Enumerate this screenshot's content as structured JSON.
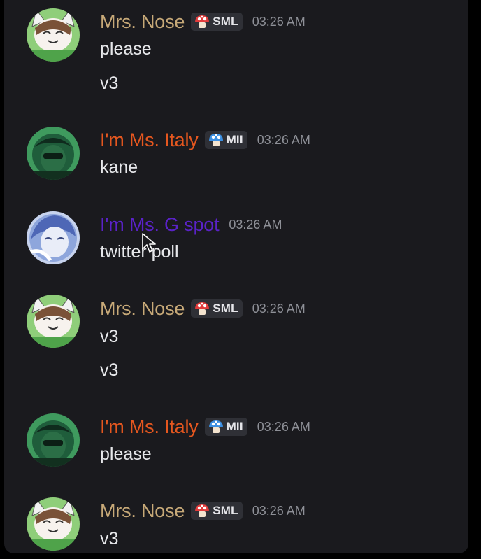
{
  "messages": [
    {
      "author": "Mrs. Nose",
      "author_color": "#c7a978",
      "tag": "SML",
      "tag_icon": "red-mushroom-icon",
      "time": "03:26 AM",
      "avatar": "avatar-mrs-nose",
      "lines": [
        "please",
        "v3"
      ]
    },
    {
      "author": "I'm Ms. Italy",
      "author_color": "#e5571f",
      "tag": "MII",
      "tag_icon": "blue-mushroom-icon",
      "time": "03:26 AM",
      "avatar": "avatar-ms-italy",
      "lines": [
        "kane"
      ]
    },
    {
      "author": "I'm Ms. G spot",
      "author_color": "#5a22c8",
      "time": "03:26 AM",
      "avatar": "avatar-ms-g-spot",
      "lines": [
        "twitter poll"
      ]
    },
    {
      "author": "Mrs. Nose",
      "author_color": "#c7a978",
      "tag": "SML",
      "tag_icon": "red-mushroom-icon",
      "time": "03:26 AM",
      "avatar": "avatar-mrs-nose",
      "lines": [
        "v3",
        "v3"
      ]
    },
    {
      "author": "I'm Ms. Italy",
      "author_color": "#e5571f",
      "tag": "MII",
      "tag_icon": "blue-mushroom-icon",
      "time": "03:26 AM",
      "avatar": "avatar-ms-italy",
      "lines": [
        "please"
      ]
    },
    {
      "author": "Mrs. Nose",
      "author_color": "#c7a978",
      "tag": "SML",
      "tag_icon": "red-mushroom-icon",
      "time": "03:26 AM",
      "avatar": "avatar-mrs-nose",
      "lines": [
        "v3"
      ]
    }
  ],
  "colors": {
    "background": "#1a1a1e",
    "message_text": "#e6e7ea",
    "timestamp": "#8e9097",
    "tag_background": "#2f3036"
  }
}
